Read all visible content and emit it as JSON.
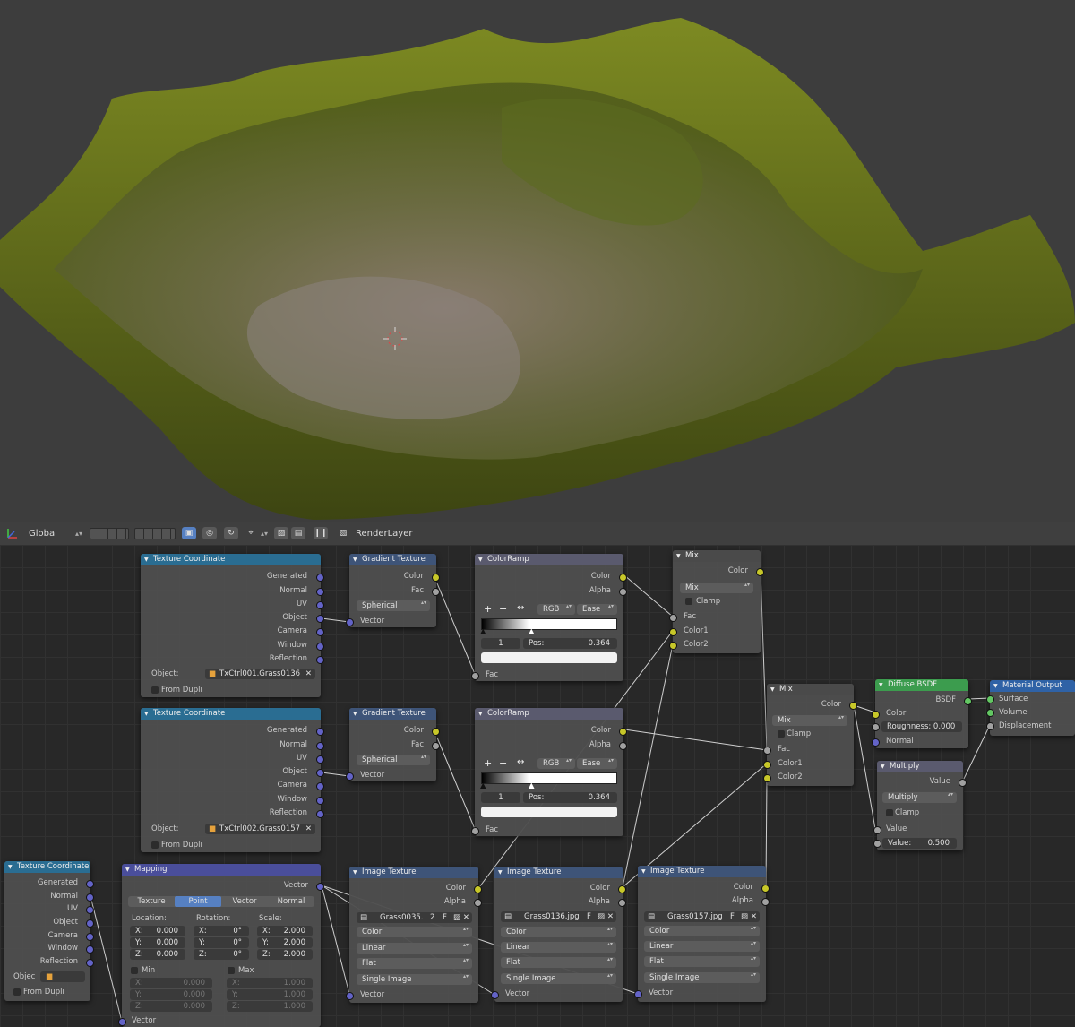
{
  "header": {
    "orientation": "Global",
    "render_layer": "RenderLayer"
  },
  "nodes": {
    "tc1": {
      "title": "Texture Coordinate",
      "outputs": [
        "Generated",
        "Normal",
        "UV",
        "Object",
        "Camera",
        "Window",
        "Reflection"
      ],
      "object_label": "Object:",
      "object_value": "TxCtrl001.Grass0136",
      "from_dupli": "From Dupli"
    },
    "tc2": {
      "title": "Texture Coordinate",
      "outputs": [
        "Generated",
        "Normal",
        "UV",
        "Object",
        "Camera",
        "Window",
        "Reflection"
      ],
      "object_label": "Object:",
      "object_value": "TxCtrl002.Grass0157",
      "from_dupli": "From Dupli"
    },
    "tc3": {
      "title": "Texture Coordinate",
      "outputs": [
        "Generated",
        "Normal",
        "UV",
        "Object",
        "Camera",
        "Window",
        "Reflection"
      ],
      "object_label": "Objec",
      "from_dupli": "From Dupli"
    },
    "grad1": {
      "title": "Gradient Texture",
      "out_color": "Color",
      "out_fac": "Fac",
      "type": "Spherical",
      "in_vector": "Vector"
    },
    "grad2": {
      "title": "Gradient Texture",
      "out_color": "Color",
      "out_fac": "Fac",
      "type": "Spherical",
      "in_vector": "Vector"
    },
    "ramp1": {
      "title": "ColorRamp",
      "out_color": "Color",
      "out_alpha": "Alpha",
      "mode": "RGB",
      "interp": "Ease",
      "index": "1",
      "pos_label": "Pos:",
      "pos": "0.364",
      "in_fac": "Fac"
    },
    "ramp2": {
      "title": "ColorRamp",
      "out_color": "Color",
      "out_alpha": "Alpha",
      "mode": "RGB",
      "interp": "Ease",
      "index": "1",
      "pos_label": "Pos:",
      "pos": "0.364",
      "in_fac": "Fac"
    },
    "mix1": {
      "title": "Mix",
      "out_color": "Color",
      "blend": "Mix",
      "clamp": "Clamp",
      "in_fac": "Fac",
      "in_c1": "Color1",
      "in_c2": "Color2"
    },
    "mix2": {
      "title": "Mix",
      "out_color": "Color",
      "blend": "Mix",
      "clamp": "Clamp",
      "in_fac": "Fac",
      "in_c1": "Color1",
      "in_c2": "Color2"
    },
    "diffuse": {
      "title": "Diffuse BSDF",
      "out": "BSDF",
      "in_color": "Color",
      "roughness": "Roughness: 0.000",
      "in_normal": "Normal"
    },
    "multiply": {
      "title": "Multiply",
      "out": "Value",
      "op": "Multiply",
      "clamp": "Clamp",
      "in_value": "Value",
      "value_field": "Value:",
      "value": "0.500"
    },
    "output": {
      "title": "Material Output",
      "surface": "Surface",
      "volume": "Volume",
      "displacement": "Displacement"
    },
    "mapping": {
      "title": "Mapping",
      "out_vector": "Vector",
      "tabs": [
        "Texture",
        "Point",
        "Vector",
        "Normal"
      ],
      "active_tab": "Point",
      "loc_label": "Location:",
      "rot_label": "Rotation:",
      "scale_label": "Scale:",
      "loc": [
        "0.000",
        "0.000",
        "0.000"
      ],
      "rot": [
        "0°",
        "0°",
        "0°"
      ],
      "scale": [
        "2.000",
        "2.000",
        "2.000"
      ],
      "axes": [
        "X:",
        "Y:",
        "Z:"
      ],
      "min_label": "Min",
      "max_label": "Max",
      "min": [
        "0.000",
        "0.000",
        "0.000"
      ],
      "max": [
        "1.000",
        "1.000",
        "1.000"
      ],
      "in_vector": "Vector"
    },
    "img1": {
      "title": "Image Texture",
      "out_color": "Color",
      "out_alpha": "Alpha",
      "file": "Grass0035.",
      "users": "2",
      "fake": "F",
      "colorspace": "Color",
      "interp": "Linear",
      "projection": "Flat",
      "source": "Single Image",
      "in_vector": "Vector"
    },
    "img2": {
      "title": "Image Texture",
      "out_color": "Color",
      "out_alpha": "Alpha",
      "file": "Grass0136.jpg",
      "fake": "F",
      "colorspace": "Color",
      "interp": "Linear",
      "projection": "Flat",
      "source": "Single Image",
      "in_vector": "Vector"
    },
    "img3": {
      "title": "Image Texture",
      "out_color": "Color",
      "out_alpha": "Alpha",
      "file": "Grass0157.jpg",
      "fake": "F",
      "colorspace": "Color",
      "interp": "Linear",
      "projection": "Flat",
      "source": "Single Image",
      "in_vector": "Vector"
    }
  }
}
